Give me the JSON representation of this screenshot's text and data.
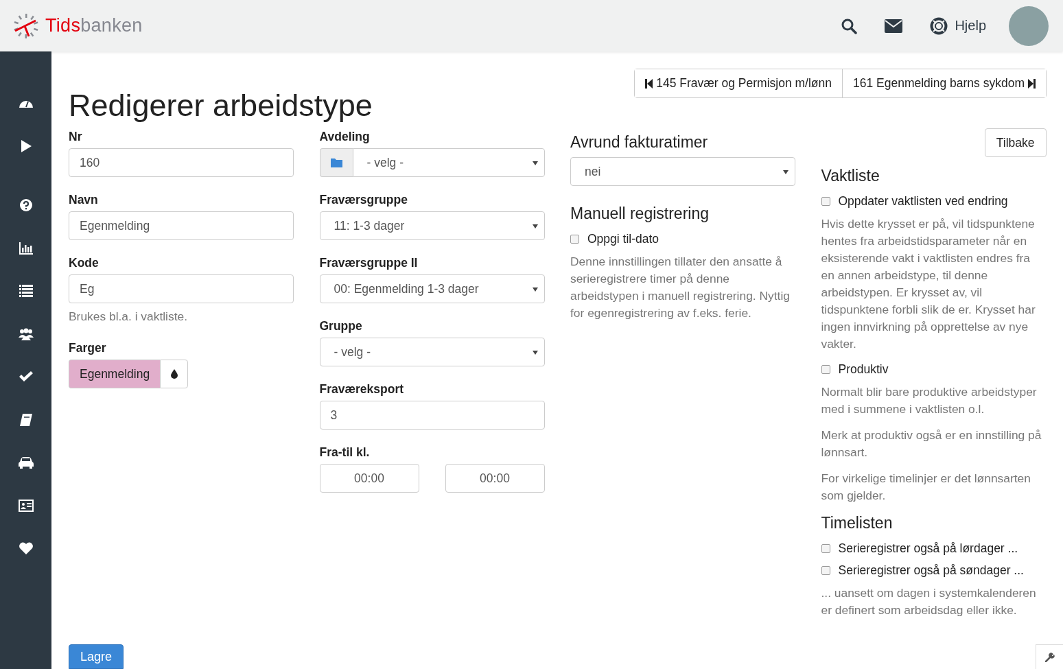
{
  "header": {
    "brand_prefix": "Tids",
    "brand_suffix": "banken",
    "help_label": "Hjelp"
  },
  "page": {
    "title": "Redigerer arbeidstype",
    "prev": "145 Fravær og Permisjon m/lønn",
    "next": "161 Egenmelding barns sykdom",
    "save": "Lagre"
  },
  "columns": [
    [
      {
        "kind": "input",
        "label": "Nr",
        "value": "160"
      },
      {
        "kind": "input",
        "label": "Navn",
        "value": "Egenmelding"
      },
      {
        "kind": "input",
        "label": "Kode",
        "value": "Eg",
        "help": "Brukes bl.a. i vaktliste."
      },
      {
        "kind": "color",
        "label": "Farger",
        "value": "Egenmelding",
        "color": "#e1aecb"
      }
    ],
    [
      {
        "kind": "select",
        "label": "Avdeling",
        "value": "- velg -",
        "addon": true
      },
      {
        "kind": "select",
        "label": "Fraværsgruppe",
        "value": "11: 1-3 dager",
        "addon": false
      },
      {
        "kind": "select",
        "label": "Fraværsgruppe II",
        "value": "00: Egenmelding 1-3 dager",
        "addon": false
      },
      {
        "kind": "select",
        "label": "Gruppe",
        "value": "- velg -",
        "addon": false
      },
      {
        "kind": "input",
        "label": "Fraværeksport",
        "value": "3"
      },
      {
        "kind": "time_range",
        "label": "Fra-til kl.",
        "from": "00:00",
        "to": "00:00"
      }
    ],
    [
      {
        "kind": "heading",
        "text": "Avrund fakturatimer"
      },
      {
        "kind": "select",
        "value": "nei",
        "addon": false
      },
      {
        "kind": "heading",
        "text": "Manuell registrering"
      },
      {
        "kind": "checkbox",
        "label": "Oppgi til-dato",
        "checked": false
      },
      {
        "kind": "help",
        "text": "Denne innstillingen tillater den ansatte å serieregistrere timer på denne arbeidstypen i manuell registrering. Nyttig for egenregistrering av f.eks. ferie."
      }
    ],
    [
      {
        "kind": "button",
        "text": "Tilbake"
      },
      {
        "kind": "heading",
        "text": "Vaktliste"
      },
      {
        "kind": "checkbox",
        "label": "Oppdater vaktlisten ved endring",
        "checked": false
      },
      {
        "kind": "help",
        "text": "Hvis dette krysset er på, vil tidspunktene hentes fra arbeidstidsparameter når en eksisterende vakt i vaktlisten endres fra en annen arbeidstype, til denne arbeidstypen. Er krysset av, vil tidspunktene forbli slik de er. Krysset har ingen innvirkning på opprettelse av nye vakter."
      },
      {
        "kind": "checkbox",
        "label": "Produktiv",
        "checked": false
      },
      {
        "kind": "help",
        "text": "Normalt blir bare produktive arbeidstyper med i summene i vaktlisten o.l."
      },
      {
        "kind": "help",
        "text": "Merk at produktiv også er en innstilling på lønnsart."
      },
      {
        "kind": "help",
        "text": "For virkelige timelinjer er det lønnsarten som gjelder."
      },
      {
        "kind": "heading",
        "text": "Timelisten"
      },
      {
        "kind": "checkbox",
        "label": "Serieregistrer også på lørdager ...",
        "checked": false
      },
      {
        "kind": "checkbox",
        "label": "Serieregistrer også på søndager ...",
        "checked": false
      },
      {
        "kind": "help",
        "text": "... uansett om dagen i systemkalenderen er definert som arbeidsdag eller ikke."
      }
    ]
  ]
}
